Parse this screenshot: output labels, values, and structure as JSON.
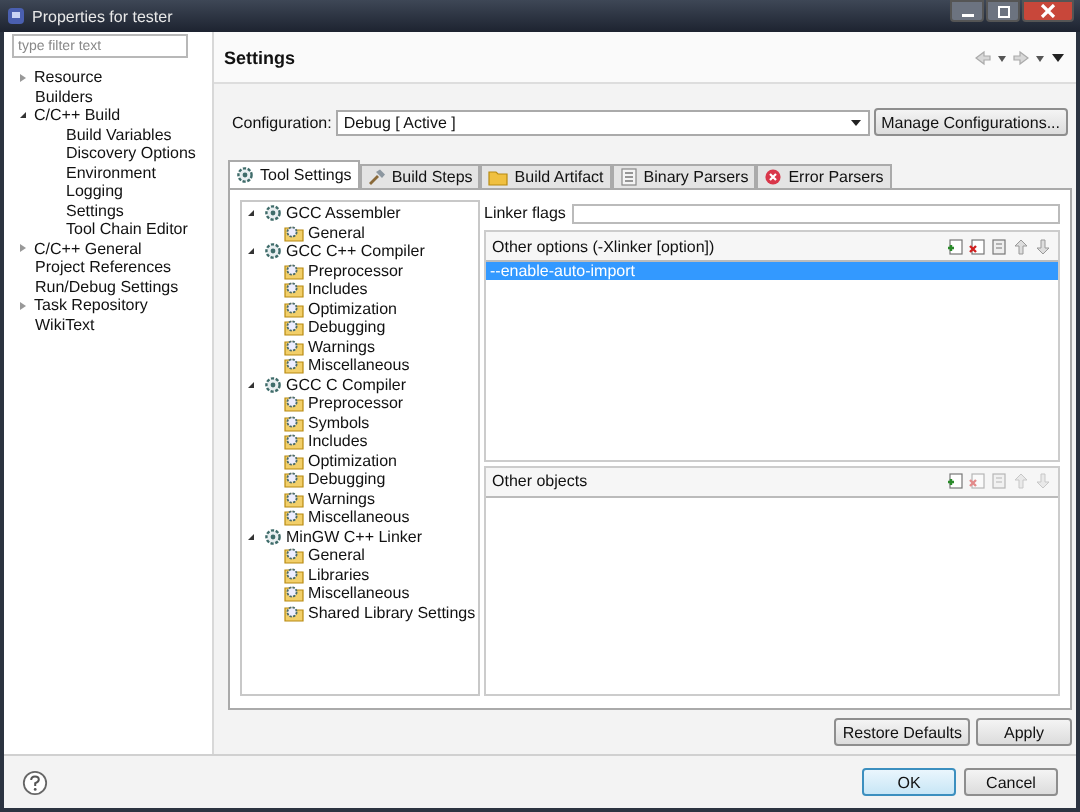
{
  "window": {
    "title": "Properties for tester"
  },
  "filter": {
    "placeholder": "type filter text"
  },
  "sidebar": {
    "items": [
      {
        "label": "Resource",
        "expanded": false
      },
      {
        "label": "Builders"
      },
      {
        "label": "C/C++ Build",
        "expanded": true,
        "children": [
          {
            "label": "Build Variables"
          },
          {
            "label": "Discovery Options"
          },
          {
            "label": "Environment"
          },
          {
            "label": "Logging"
          },
          {
            "label": "Settings"
          },
          {
            "label": "Tool Chain Editor"
          }
        ]
      },
      {
        "label": "C/C++ General",
        "expanded": false
      },
      {
        "label": "Project References"
      },
      {
        "label": "Run/Debug Settings"
      },
      {
        "label": "Task Repository",
        "expanded": false
      },
      {
        "label": "WikiText"
      }
    ]
  },
  "page": {
    "title": "Settings",
    "configuration": {
      "label": "Configuration:",
      "value": "Debug  [ Active ]"
    },
    "manage_button": "Manage Configurations...",
    "tabs": [
      {
        "label": "Tool Settings",
        "selected": true,
        "kind": "gear"
      },
      {
        "label": "Build Steps",
        "selected": false,
        "kind": "hammer"
      },
      {
        "label": "Build Artifact",
        "selected": false,
        "kind": "folder"
      },
      {
        "label": "Binary Parsers",
        "selected": false,
        "kind": "binary"
      },
      {
        "label": "Error Parsers",
        "selected": false,
        "kind": "error"
      }
    ],
    "tools": [
      {
        "label": "GCC Assembler",
        "expanded": true,
        "children": [
          {
            "label": "General"
          }
        ]
      },
      {
        "label": "GCC C++ Compiler",
        "expanded": true,
        "children": [
          {
            "label": "Preprocessor"
          },
          {
            "label": "Includes"
          },
          {
            "label": "Optimization"
          },
          {
            "label": "Debugging"
          },
          {
            "label": "Warnings"
          },
          {
            "label": "Miscellaneous"
          }
        ]
      },
      {
        "label": "GCC C Compiler",
        "expanded": true,
        "children": [
          {
            "label": "Preprocessor"
          },
          {
            "label": "Symbols"
          },
          {
            "label": "Includes"
          },
          {
            "label": "Optimization"
          },
          {
            "label": "Debugging"
          },
          {
            "label": "Warnings"
          },
          {
            "label": "Miscellaneous"
          }
        ]
      },
      {
        "label": "MinGW C++ Linker",
        "expanded": true,
        "children": [
          {
            "label": "General"
          },
          {
            "label": "Libraries"
          },
          {
            "label": "Miscellaneous"
          },
          {
            "label": "Shared Library Settings"
          }
        ]
      }
    ],
    "linker_flags": {
      "label": "Linker flags"
    },
    "lists": [
      {
        "title": "Other options (-Xlinker [option])",
        "items": [
          {
            "label": "--enable-auto-import",
            "selected": true
          }
        ]
      },
      {
        "title": "Other objects"
      }
    ],
    "buttons": [
      "Restore Defaults",
      "Apply"
    ]
  },
  "dialog_buttons": [
    "OK",
    "Cancel"
  ]
}
